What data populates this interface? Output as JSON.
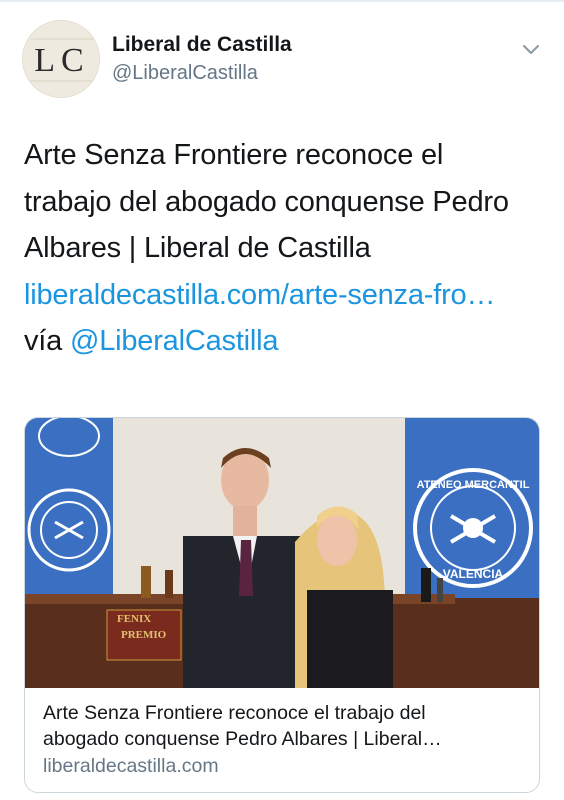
{
  "author": {
    "name": "Liberal de Castilla",
    "handle": "@LiberalCastilla",
    "avatar_text": "LC",
    "avatar_icon": "lc-logo-icon"
  },
  "menu_icon": "chevron-down-icon",
  "tweet": {
    "line1": "Arte Senza Frontiere reconoce el",
    "line2": "trabajo del abogado conquense Pedro",
    "line3": "Albares | Liberal de Castilla",
    "link_url": "liberaldecastilla.com/arte-senza-fro…",
    "via_prefix": "vía ",
    "via_mention": "@LiberalCastilla"
  },
  "card": {
    "title_line1": "Arte Senza Frontiere reconoce el trabajo del",
    "title_line2": "abogado conquense Pedro Albares | Liberal…",
    "domain": "liberaldecastilla.com",
    "image": {
      "banner_text_top": "ATENEO MERCANTIL",
      "banner_text_bottom": "VALENCIA",
      "award_text_1": "FENIX",
      "award_text_2": "PREMIO"
    }
  },
  "colors": {
    "link": "#1b95e0",
    "secondary_text": "#657786",
    "banner_blue": "#3a6fc2",
    "border": "#ccd6dd"
  }
}
